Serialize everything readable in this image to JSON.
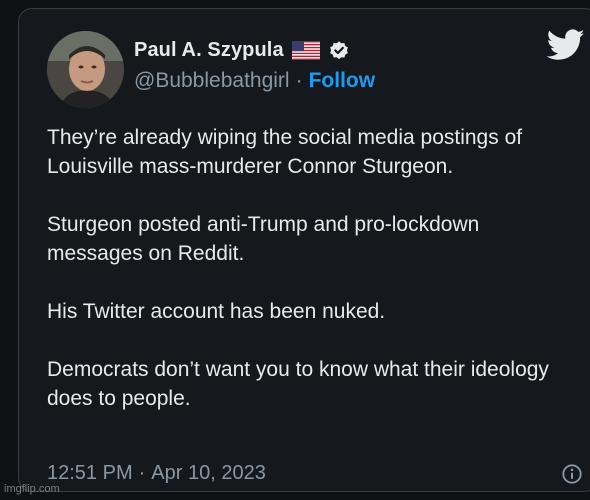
{
  "tweet": {
    "author_name": "Paul A. Szypula",
    "handle": "@Bubblebathgirl",
    "separator": "·",
    "follow_label": "Follow",
    "paragraphs": [
      "They’re already wiping the social media postings of Louisville mass-murderer Connor Sturgeon.",
      "Sturgeon posted anti-Trump and pro-lockdown messages on Reddit.",
      "His Twitter account has been nuked.",
      "Democrats don’t want you to know what their ideology does to people."
    ],
    "time": "12:51 PM",
    "date": "Apr 10, 2023",
    "icons": {
      "flag": "us-flag-icon",
      "verified": "verified-badge-icon",
      "logo": "twitter-bird-icon",
      "info": "info-icon"
    }
  },
  "colors": {
    "background": "#15181c",
    "text": "#e7e9ea",
    "muted": "#8b98a5",
    "accent": "#1d9bf0"
  },
  "watermark": "imgflip.com"
}
